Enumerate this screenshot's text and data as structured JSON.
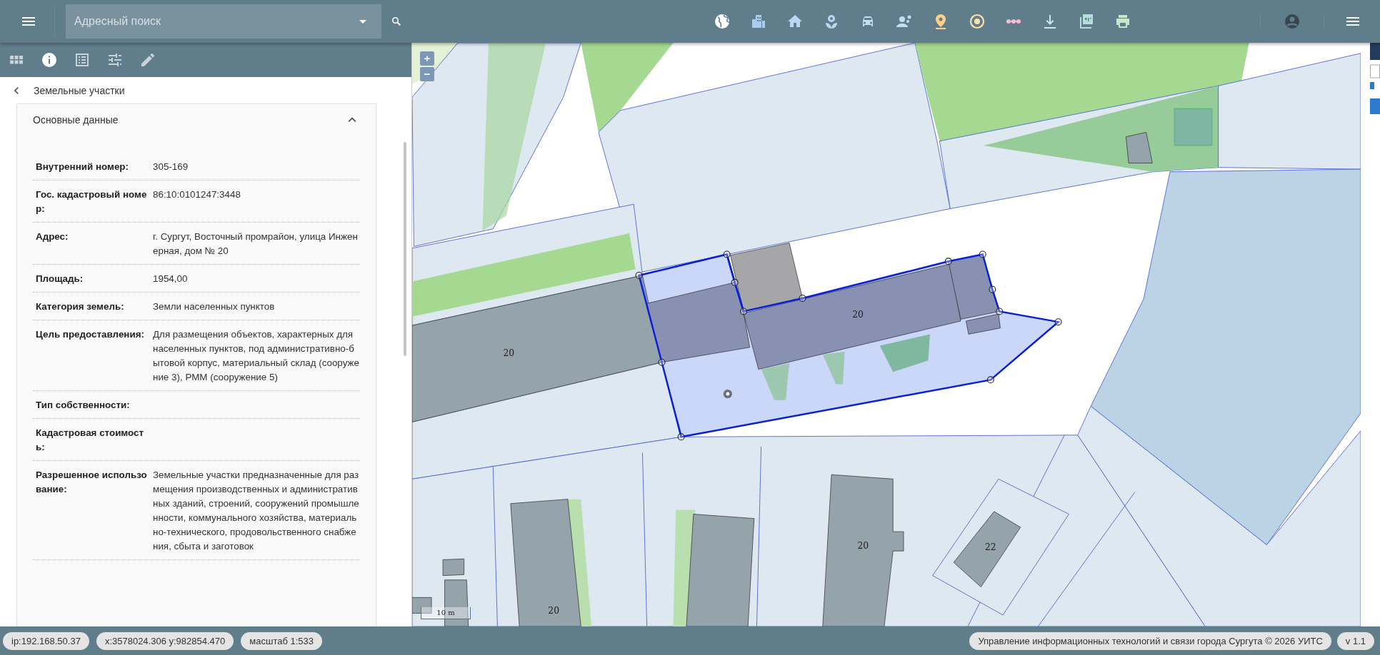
{
  "header": {
    "search": {
      "placeholder": "Адресный поиск"
    },
    "tools": [
      {
        "kind": "globe"
      },
      {
        "kind": "buildings"
      },
      {
        "kind": "home"
      },
      {
        "kind": "flower"
      },
      {
        "kind": "car"
      },
      {
        "kind": "people"
      },
      {
        "kind": "pin"
      },
      {
        "kind": "target"
      },
      {
        "kind": "dots"
      },
      {
        "kind": "download"
      },
      {
        "kind": "pdf"
      },
      {
        "kind": "printer"
      }
    ]
  },
  "panel_tabs": [
    {
      "kind": "grid",
      "selected": false
    },
    {
      "kind": "info",
      "selected": true
    },
    {
      "kind": "list",
      "selected": false
    },
    {
      "kind": "sliders",
      "selected": false
    },
    {
      "kind": "pencil",
      "selected": false
    }
  ],
  "breadcrumb": {
    "title": "Земельные участки"
  },
  "section": {
    "title": "Основные данные",
    "expanded": true,
    "fields": [
      {
        "label": "Внутренний номер:",
        "value": "305-169"
      },
      {
        "label": "Гос. кадастровый номер:",
        "value": "86:10:0101247:3448"
      },
      {
        "label": "Адрес:",
        "value": "г. Сургут, Восточный промрайон, улица Инженерная, дом № 20"
      },
      {
        "label": "Площадь:",
        "value": "1954,00"
      },
      {
        "label": "Категория земель:",
        "value": "Земли населенных пунктов"
      },
      {
        "label": "Цель предоставления:",
        "value": "Для размещения объектов, характерных для населенных пунктов, под административно-бытовой корпус, материальный склад (сооружение 3), РММ (сооружение 5)"
      },
      {
        "label": "Тип собственности:"
      },
      {
        "label": "Кадастровая стоимость:"
      },
      {
        "label": "Разрешенное использование:",
        "value": "Земельные участки предназначенные для размещения производственных и административных зданий, строений, сооружений промышленности, коммунального хозяйства, материально-технического, продовольственного снабжения, сбыта и заготовок"
      }
    ]
  },
  "map": {
    "zoom_in": "+",
    "zoom_out": "−",
    "labels": [
      "20",
      "20",
      "20",
      "20",
      "22"
    ],
    "scale": "10 m"
  },
  "status_bar": {
    "chips": [
      "ip:192.168.50.37",
      "x:3578024.306 y:982854.470",
      "масштаб 1:533"
    ],
    "credits": "Управление информационных технологий и связи города Сургута © 2026 УИТС",
    "version": "v 1.1"
  }
}
